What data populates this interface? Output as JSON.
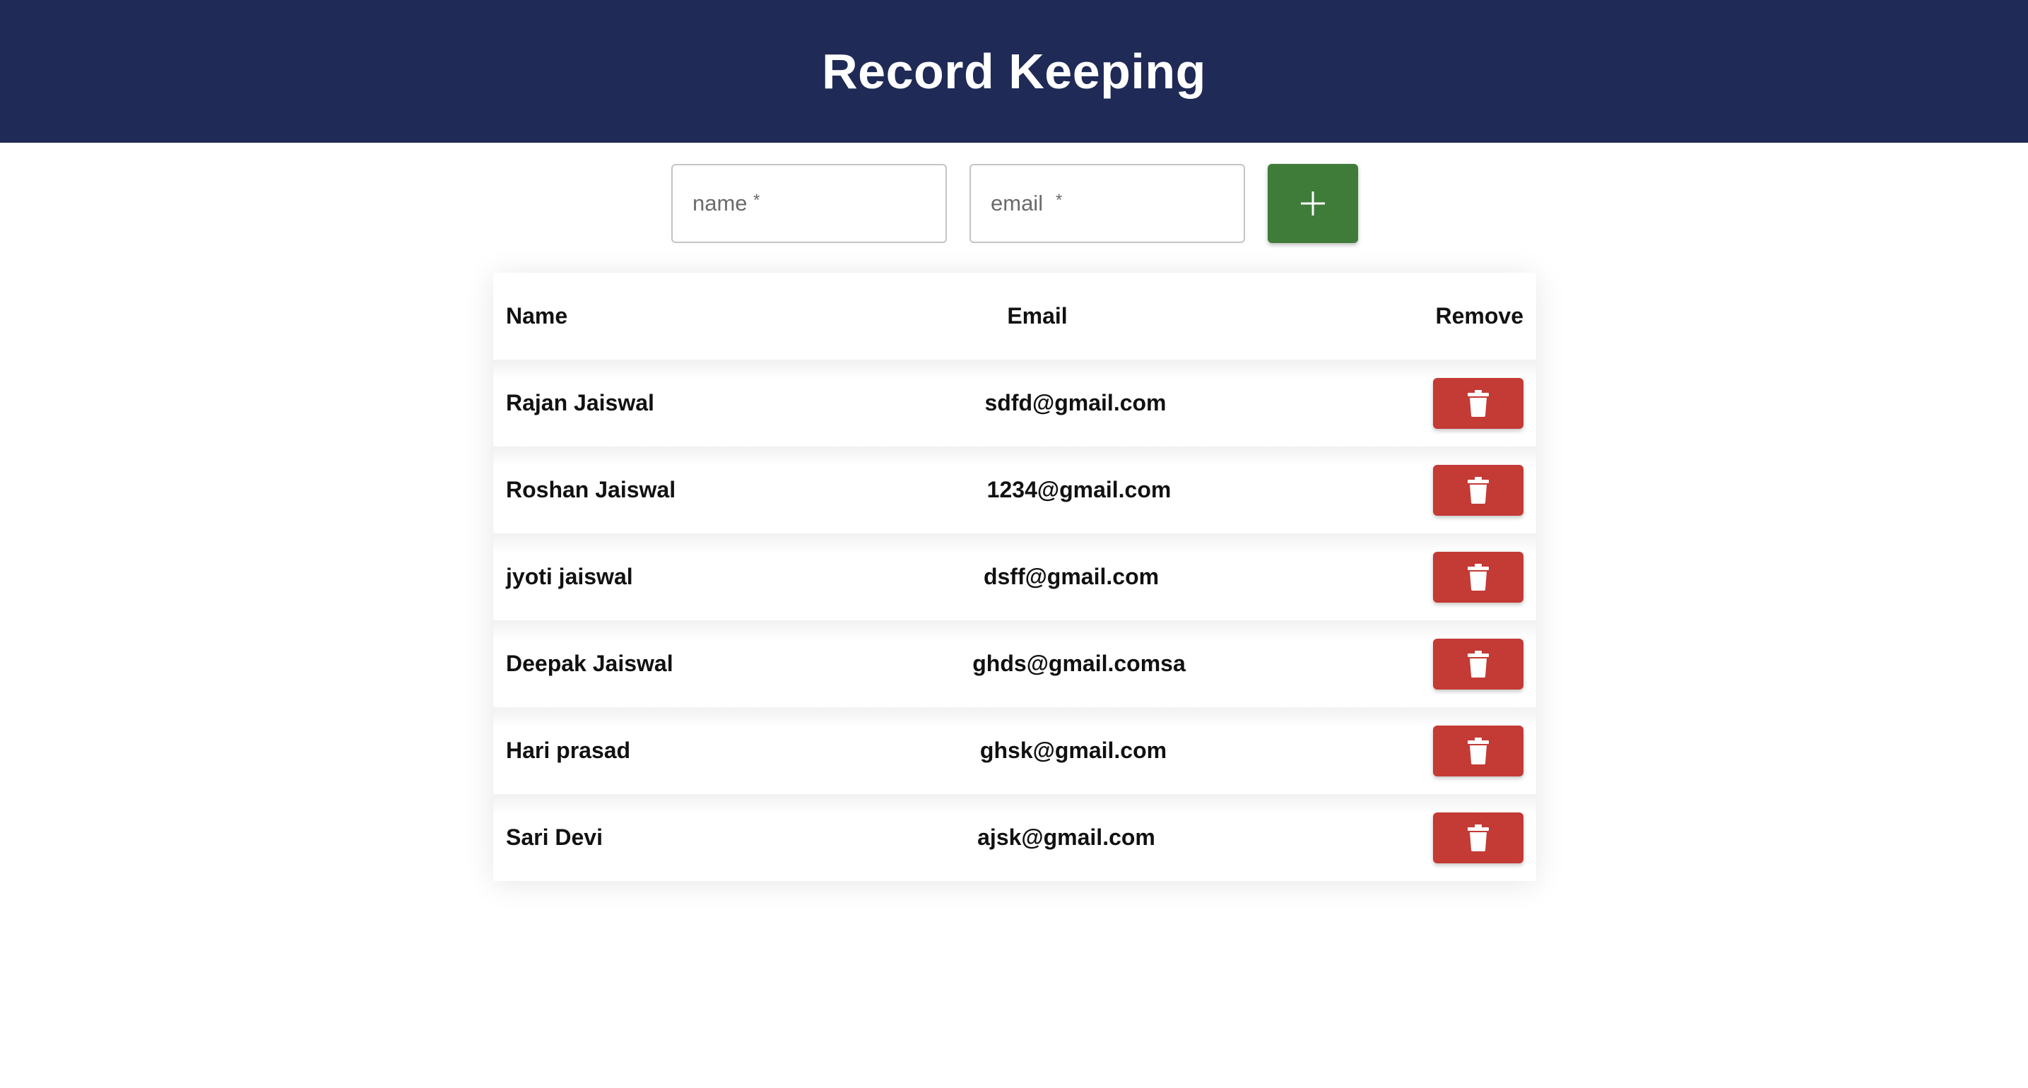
{
  "header": {
    "title": "Record Keeping"
  },
  "form": {
    "name_placeholder": "name",
    "email_placeholder": "email",
    "required_mark": "*",
    "add_icon": "plus-icon"
  },
  "table": {
    "columns": {
      "name": "Name",
      "email": "Email",
      "remove": "Remove"
    },
    "rows": [
      {
        "name": "Rajan Jaiswal",
        "email": "sdfd@gmail.com"
      },
      {
        "name": "Roshan Jaiswal",
        "email": "1234@gmail.com"
      },
      {
        "name": "jyoti jaiswal",
        "email": "dsff@gmail.com"
      },
      {
        "name": "Deepak Jaiswal",
        "email": "ghds@gmail.comsa"
      },
      {
        "name": "Hari prasad",
        "email": "ghsk@gmail.com"
      },
      {
        "name": "Sari Devi",
        "email": "ajsk@gmail.com"
      }
    ],
    "remove_icon": "trash-icon"
  },
  "colors": {
    "header_bg": "#1f2a56",
    "add_button": "#3f7c39",
    "delete_button": "#c43a35"
  }
}
